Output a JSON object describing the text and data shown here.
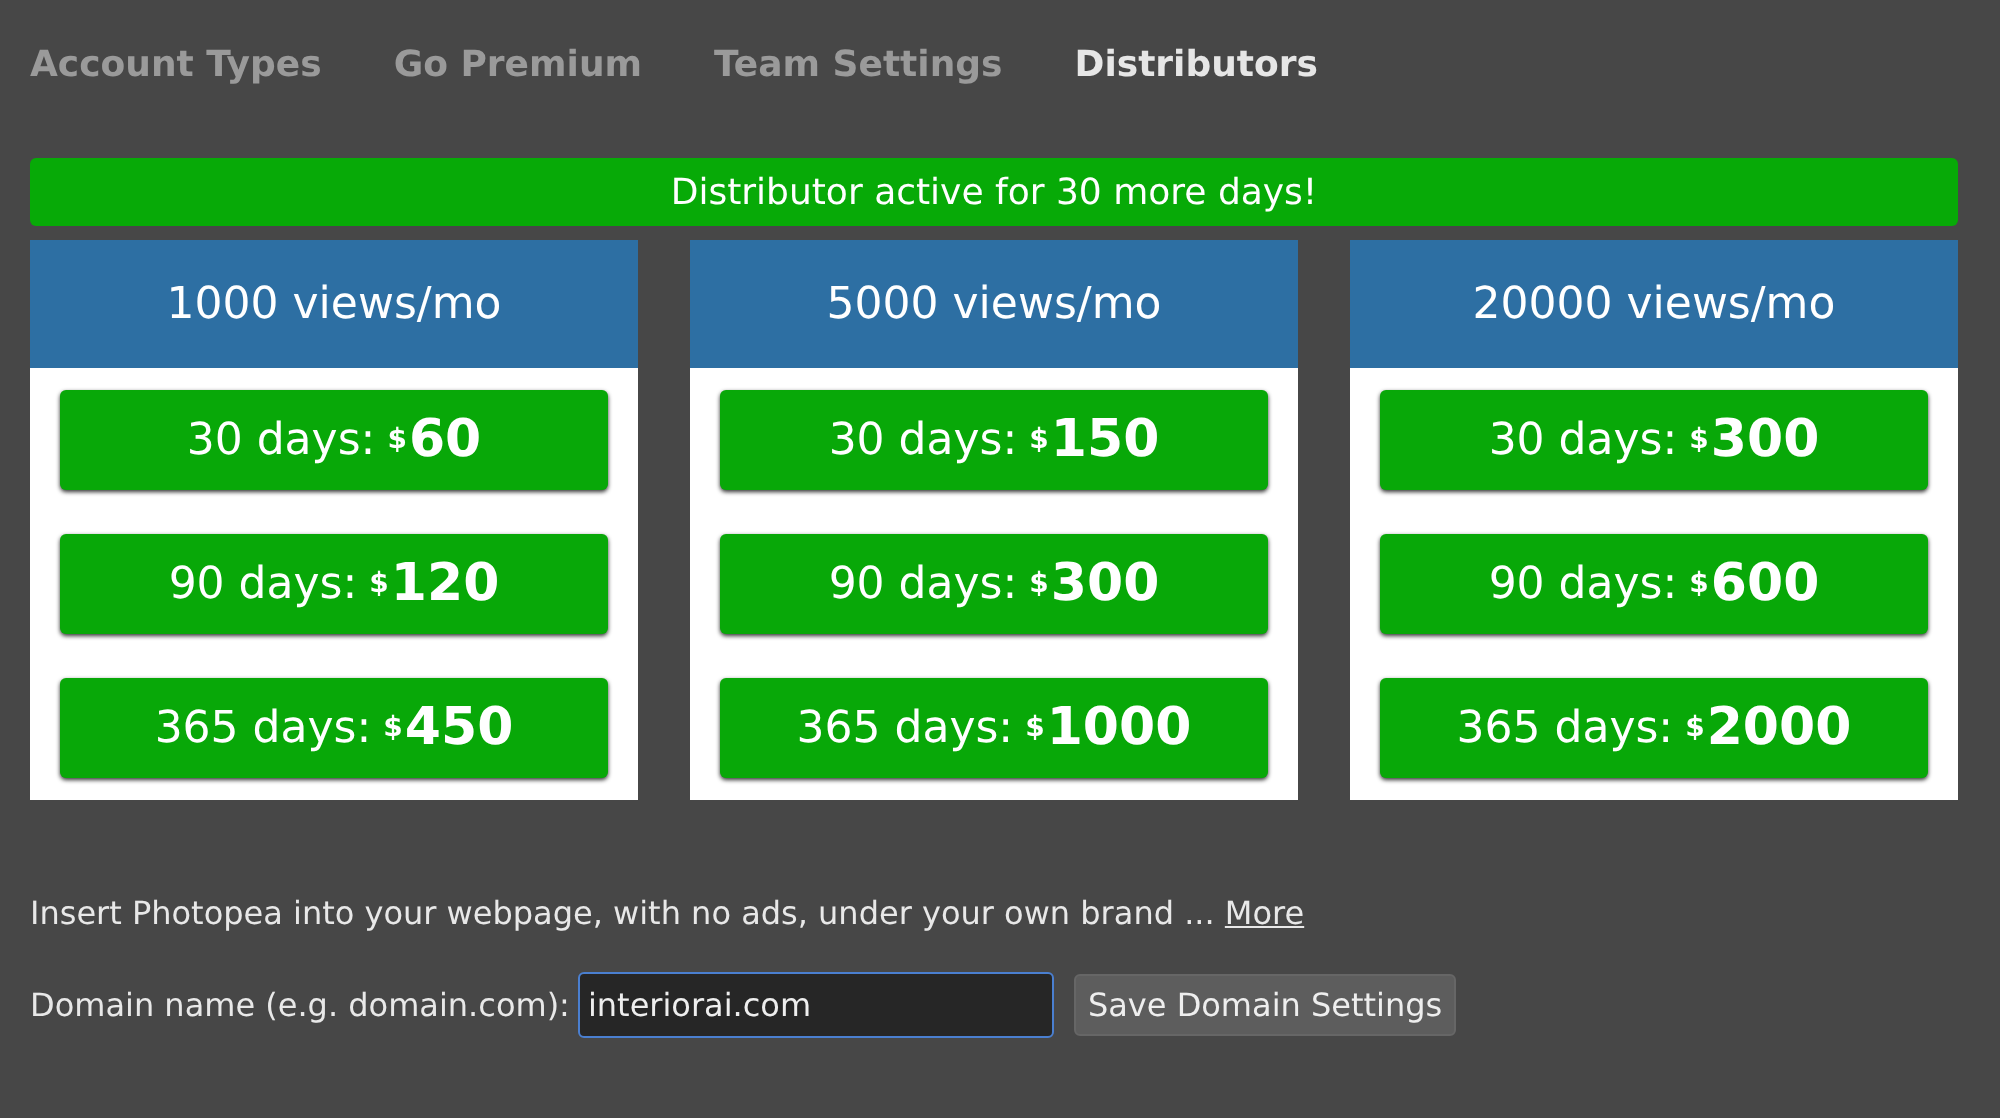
{
  "tabs": [
    {
      "label": "Account Types",
      "selected": false
    },
    {
      "label": "Go Premium",
      "selected": false
    },
    {
      "label": "Team Settings",
      "selected": false
    },
    {
      "label": "Distributors",
      "selected": true
    }
  ],
  "banner": "Distributor active for 30 more days!",
  "plans": [
    {
      "title": "1000 views/mo",
      "options": [
        {
          "label": "30 days:",
          "currency": "$",
          "price": "60"
        },
        {
          "label": "90 days:",
          "currency": "$",
          "price": "120"
        },
        {
          "label": "365 days:",
          "currency": "$",
          "price": "450"
        }
      ]
    },
    {
      "title": "5000 views/mo",
      "options": [
        {
          "label": "30 days:",
          "currency": "$",
          "price": "150"
        },
        {
          "label": "90 days:",
          "currency": "$",
          "price": "300"
        },
        {
          "label": "365 days:",
          "currency": "$",
          "price": "1000"
        }
      ]
    },
    {
      "title": "20000 views/mo",
      "options": [
        {
          "label": "30 days:",
          "currency": "$",
          "price": "300"
        },
        {
          "label": "90 days:",
          "currency": "$",
          "price": "600"
        },
        {
          "label": "365 days:",
          "currency": "$",
          "price": "2000"
        }
      ]
    }
  ],
  "info": {
    "text": "Insert Photopea into your webpage, with no ads, under your own brand ...",
    "link": "More"
  },
  "domain": {
    "label": "Domain name (e.g. domain.com):",
    "value": "interiorai.com",
    "button": "Save Domain Settings"
  }
}
